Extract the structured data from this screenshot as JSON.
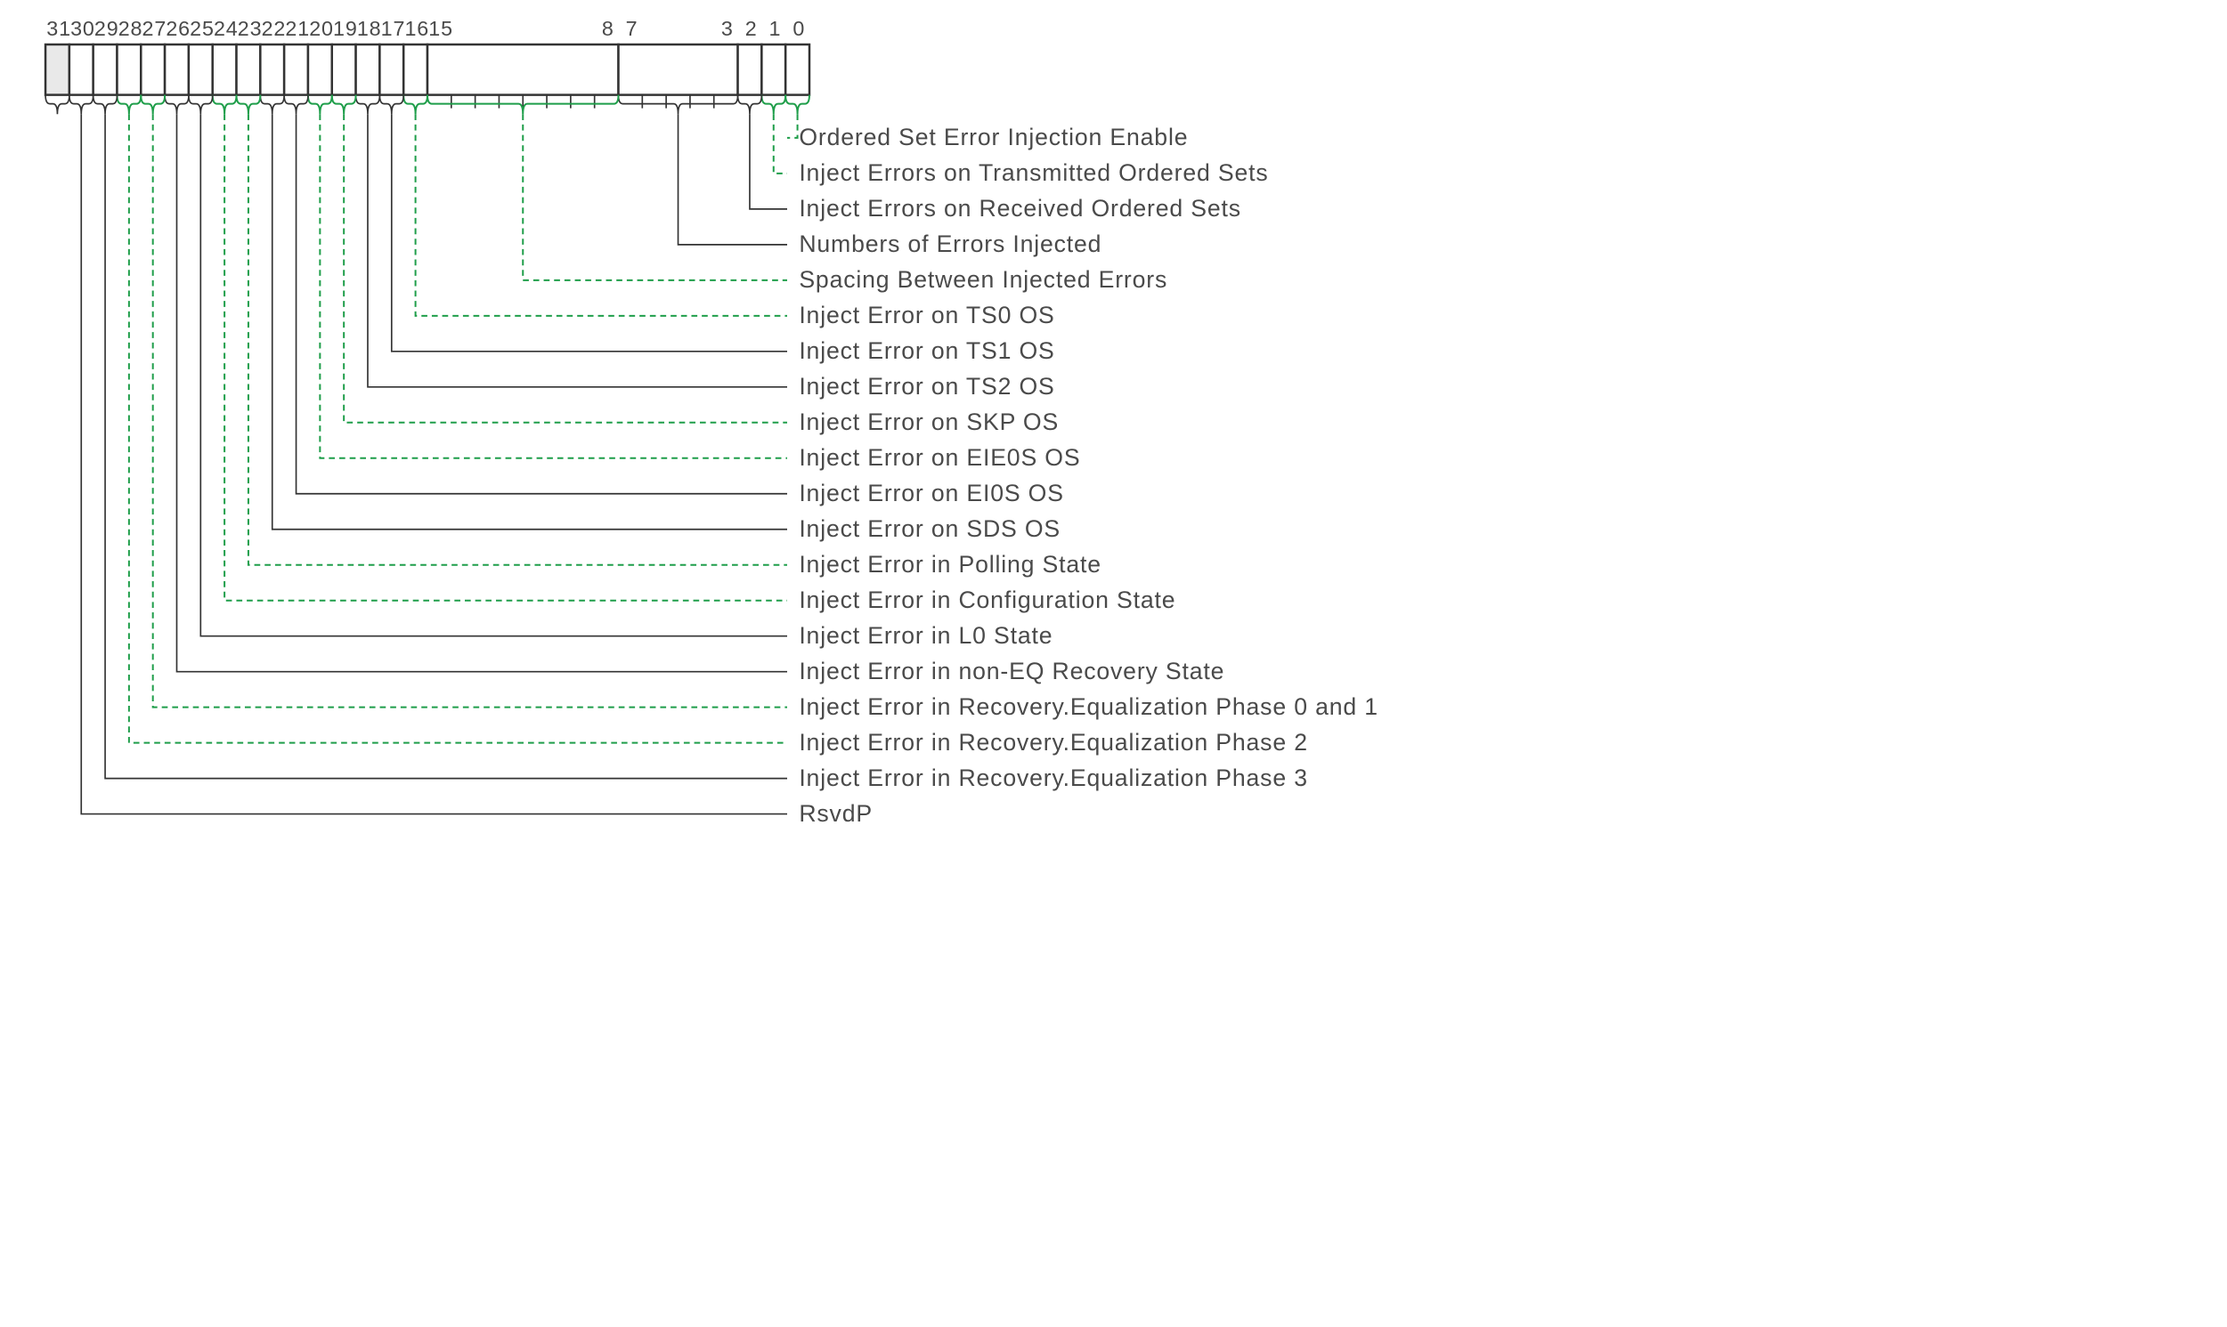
{
  "register_width_bits": 32,
  "bit_labels_top": [
    "31",
    "30",
    "29",
    "28",
    "27",
    "26",
    "25",
    "24",
    "23",
    "22",
    "21",
    "20",
    "19",
    "18",
    "17",
    "16",
    "15",
    "8",
    "7",
    "3",
    "2",
    "1",
    "0"
  ],
  "fields": [
    {
      "hi": 0,
      "lo": 0,
      "label": "Ordered Set Error Injection Enable",
      "style": "dashed"
    },
    {
      "hi": 1,
      "lo": 1,
      "label": "Inject Errors on Transmitted Ordered Sets",
      "style": "dashed"
    },
    {
      "hi": 2,
      "lo": 2,
      "label": "Inject Errors on Received Ordered Sets",
      "style": "solid"
    },
    {
      "hi": 7,
      "lo": 3,
      "label": "Numbers of Errors Injected",
      "style": "solid"
    },
    {
      "hi": 15,
      "lo": 8,
      "label": "Spacing Between Injected Errors",
      "style": "dashed"
    },
    {
      "hi": 16,
      "lo": 16,
      "label": "Inject Error on TS0 OS",
      "style": "dashed"
    },
    {
      "hi": 17,
      "lo": 17,
      "label": "Inject Error on TS1 OS",
      "style": "solid"
    },
    {
      "hi": 18,
      "lo": 18,
      "label": "Inject Error on TS2 OS",
      "style": "solid"
    },
    {
      "hi": 19,
      "lo": 19,
      "label": "Inject Error on SKP OS",
      "style": "dashed"
    },
    {
      "hi": 20,
      "lo": 20,
      "label": "Inject Error on EIE0S OS",
      "style": "dashed"
    },
    {
      "hi": 21,
      "lo": 21,
      "label": "Inject Error on EI0S OS",
      "style": "solid"
    },
    {
      "hi": 22,
      "lo": 22,
      "label": "Inject Error on SDS OS",
      "style": "solid"
    },
    {
      "hi": 23,
      "lo": 23,
      "label": "Inject Error in Polling State",
      "style": "dashed"
    },
    {
      "hi": 24,
      "lo": 24,
      "label": "Inject Error in Configuration State",
      "style": "dashed"
    },
    {
      "hi": 25,
      "lo": 25,
      "label": "Inject Error in L0 State",
      "style": "solid"
    },
    {
      "hi": 26,
      "lo": 26,
      "label": "Inject Error in non-EQ Recovery State",
      "style": "solid"
    },
    {
      "hi": 27,
      "lo": 27,
      "label": "Inject Error in Recovery.Equalization Phase 0 and 1",
      "style": "dashed"
    },
    {
      "hi": 28,
      "lo": 28,
      "label": "Inject Error in Recovery.Equalization Phase 2",
      "style": "dashed"
    },
    {
      "hi": 29,
      "lo": 29,
      "label": "Inject Error in Recovery.Equalization Phase 3",
      "style": "solid"
    },
    {
      "hi": 30,
      "lo": 30,
      "label": "RsvdP",
      "style": "solid"
    }
  ],
  "reserved_bits": [
    31
  ]
}
